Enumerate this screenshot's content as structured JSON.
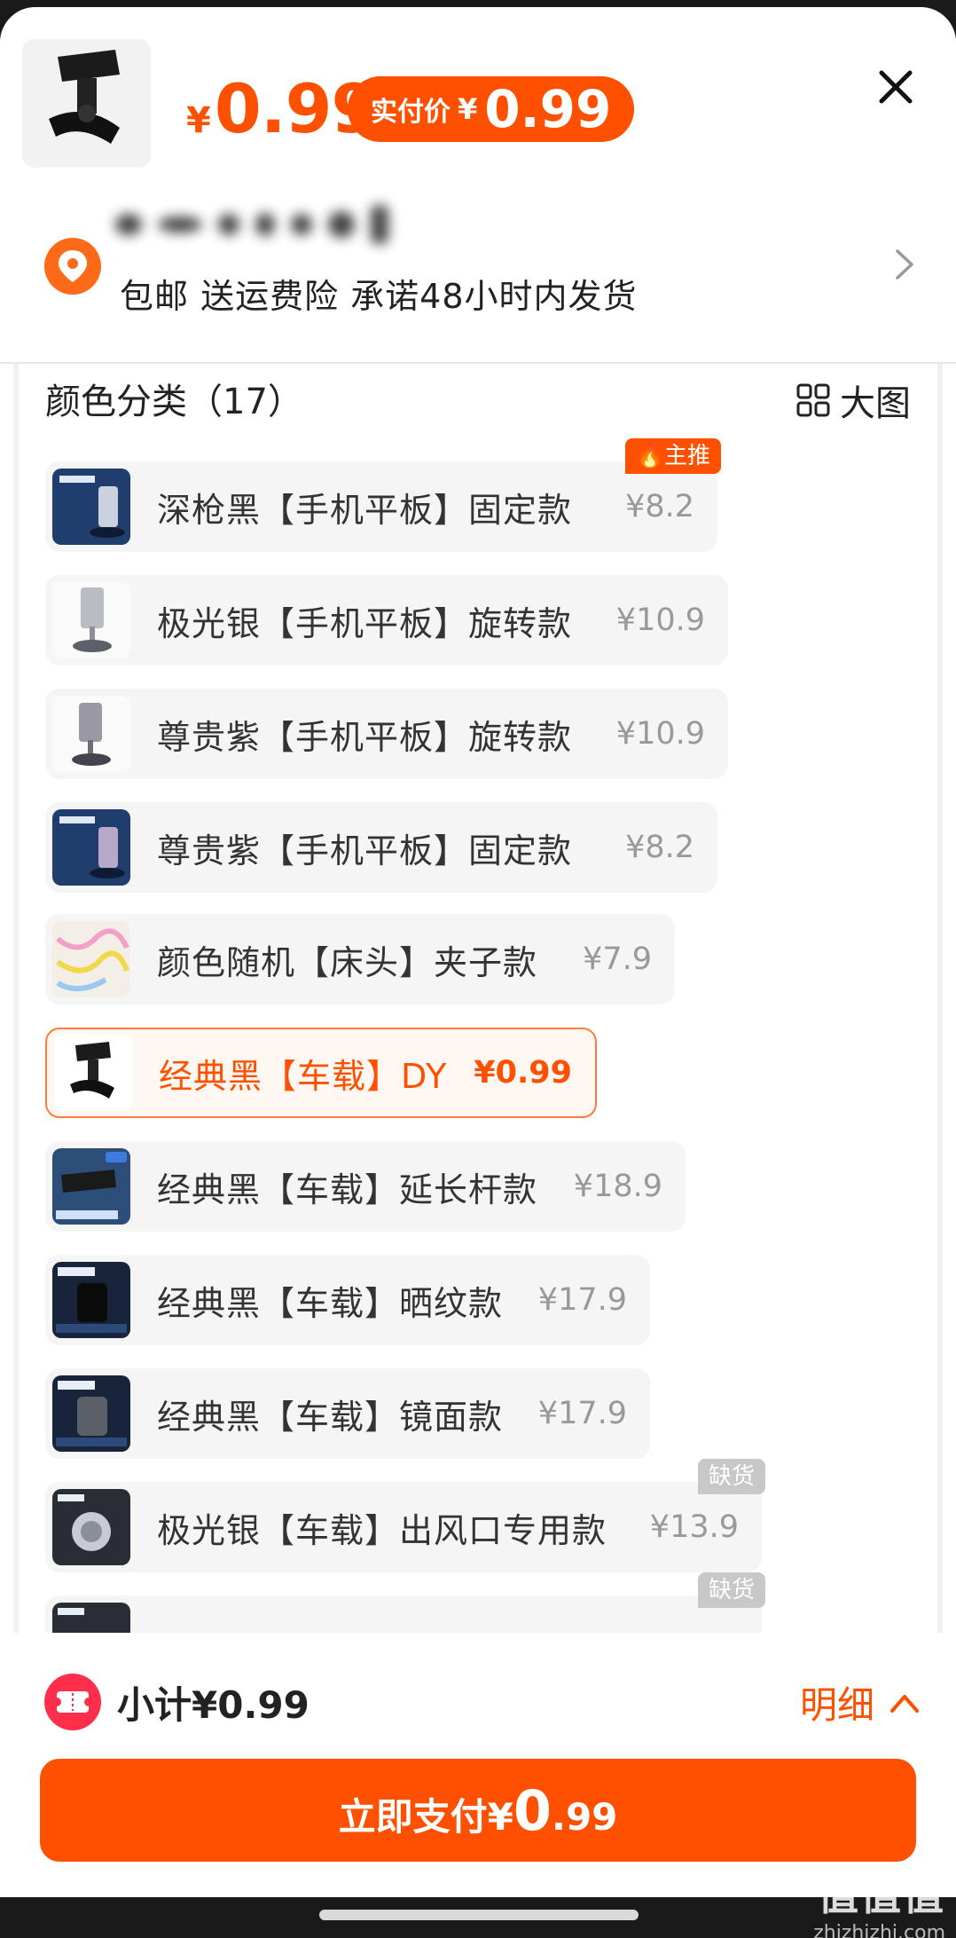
{
  "header": {
    "price_symbol": "¥",
    "price": "0.99",
    "paid_label": "实付价",
    "paid_symbol": "¥",
    "paid_value": "0.99"
  },
  "address": {
    "shipping_info": "包邮 送运费险 承诺48小时内发货"
  },
  "options": {
    "title": "颜色分类（17）",
    "big_pic_label": "大图",
    "items": [
      {
        "name": "深枪黑【手机平板】固定款",
        "price": "¥8.2",
        "tag": "主推"
      },
      {
        "name": "极光银【手机平板】旋转款",
        "price": "¥10.9"
      },
      {
        "name": "尊贵紫【手机平板】旋转款",
        "price": "¥10.9"
      },
      {
        "name": "尊贵紫【手机平板】固定款",
        "price": "¥8.2"
      },
      {
        "name": "颜色随机【床头】夹子款",
        "price": "¥7.9"
      },
      {
        "name": "经典黑【车载】DY",
        "price": "¥0.99",
        "selected": true
      },
      {
        "name": "经典黑【车载】延长杆款",
        "price": "¥18.9"
      },
      {
        "name": "经典黑【车载】晒纹款",
        "price": "¥17.9"
      },
      {
        "name": "经典黑【车载】镜面款",
        "price": "¥17.9"
      },
      {
        "name": "极光银【车载】出风口专用款",
        "price": "¥13.9",
        "tag": "缺货"
      },
      {
        "name": "",
        "price": "",
        "tag": "缺货"
      }
    ]
  },
  "footer": {
    "subtotal": "小计¥0.99",
    "detail_label": "明细",
    "pay_label": "立即支付",
    "pay_symbol": "¥",
    "pay_int": "0",
    "pay_dec": ".99"
  },
  "watermark": {
    "line1": "值值值",
    "line2": "zhizhizhi.com"
  },
  "colors": {
    "accent": "#ff5000",
    "selected_bg": "#fff7f2",
    "item_bg": "#f5f5f5",
    "coupon": "#ff2e4a",
    "out_of_stock": "#c8c8c8"
  }
}
